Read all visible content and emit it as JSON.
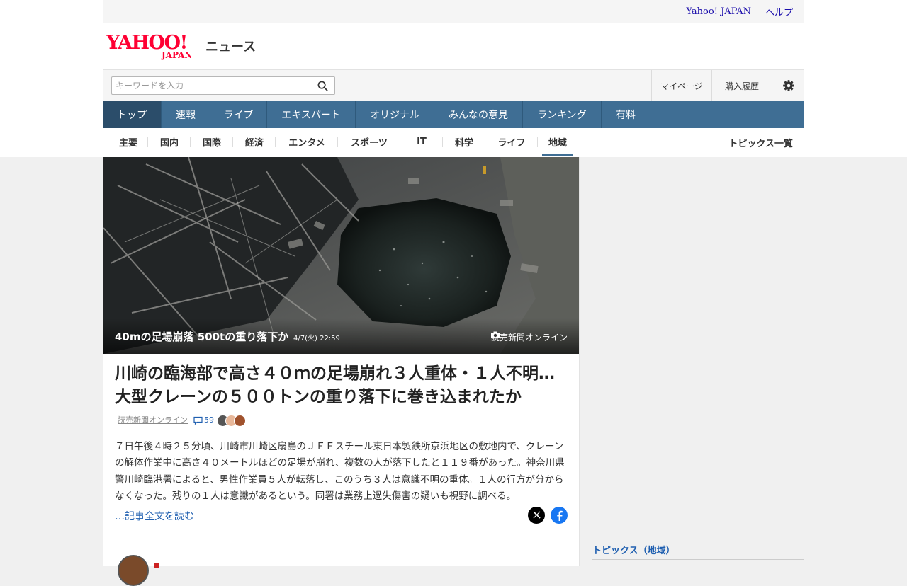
{
  "utility": {
    "yahoo_japan": "Yahoo! JAPAN",
    "help": "ヘルプ"
  },
  "logo": {
    "yahoo": "YAHOO!",
    "japan": "JAPAN",
    "news": "ニュース"
  },
  "search": {
    "placeholder": "キーワードを入力",
    "value": ""
  },
  "account": {
    "mypage": "マイページ",
    "history": "購入履歴"
  },
  "main_nav": [
    {
      "label": "トップ",
      "active": true
    },
    {
      "label": "速報"
    },
    {
      "label": "ライブ"
    },
    {
      "label": "エキスパート"
    },
    {
      "label": "オリジナル"
    },
    {
      "label": "みんなの意見"
    },
    {
      "label": "ランキング"
    },
    {
      "label": "有料"
    }
  ],
  "sub_nav": [
    {
      "label": "主要"
    },
    {
      "label": "国内"
    },
    {
      "label": "国際"
    },
    {
      "label": "経済"
    },
    {
      "label": "エンタメ"
    },
    {
      "label": "スポーツ"
    },
    {
      "label": "IT"
    },
    {
      "label": "科学"
    },
    {
      "label": "ライフ"
    },
    {
      "label": "地域",
      "active": true
    }
  ],
  "topics_all": "トピックス一覧",
  "photo": {
    "caption": "40mの足場崩落 500tの重り落下か",
    "date": "4/7(火) 22:59",
    "source": "読売新聞オンライン"
  },
  "article": {
    "headline": "川崎の臨海部で高さ４０ｍの足場崩れ３人重体・１人不明…大型クレーンの５００トンの重り落下に巻き込まれたか",
    "source": "読売新聞オンライン",
    "comment_count": "59",
    "body": "７日午後４時２５分頃、川崎市川崎区扇島のＪＦＥスチール東日本製鉄所京浜地区の敷地内で、クレーンの解体作業中に高さ４０メートルほどの足場が崩れ、複数の人が落下したと１１９番があった。神奈川県警川崎臨港署によると、男性作業員５人が転落し、このうち３人は意識不明の重体。１人の行方が分からなくなった。残りの１人は意識があるという。同署は業務上過失傷害の疑いも視野に調べる。",
    "read_more": "…記事全文を読む"
  },
  "sidebar": {
    "topics_title": "トピックス（地域）"
  },
  "colors": {
    "brand_red": "#ff0033",
    "nav_blue": "#3f6e94",
    "link_blue": "#1f5fb0"
  }
}
